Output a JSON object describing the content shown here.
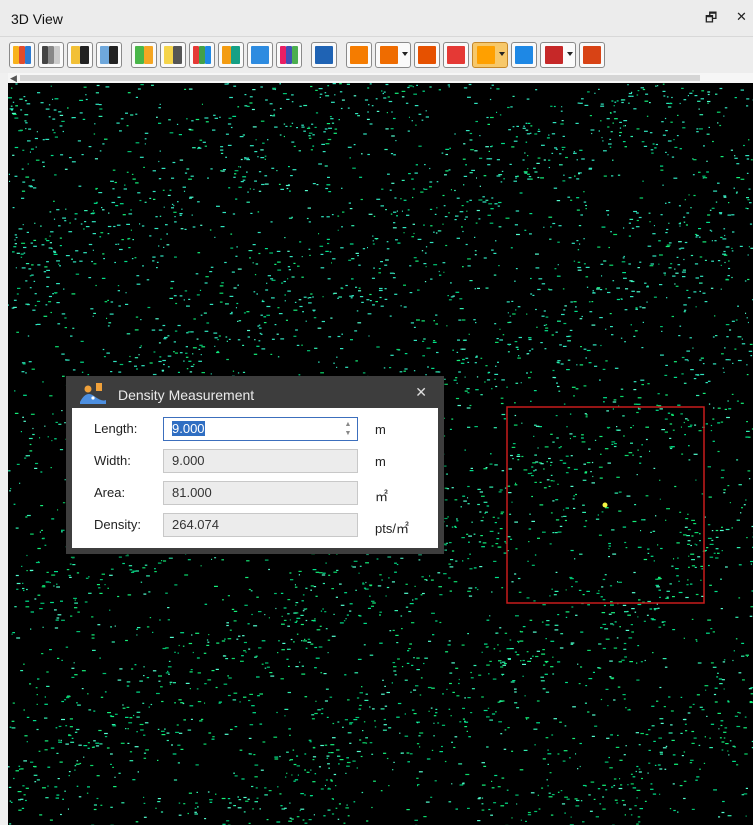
{
  "window": {
    "title": "3D View",
    "float_glyph": "🗗",
    "close_glyph": "✕"
  },
  "toolbar": {
    "buttons": [
      {
        "name": "color-by-elevation",
        "icon": "elevation-icon",
        "colors": [
          "#f8b21b",
          "#e04b2b",
          "#2b7ad1"
        ]
      },
      {
        "name": "color-by-intensity",
        "icon": "intensity-icon",
        "colors": [
          "#444",
          "#888",
          "#ccc"
        ]
      },
      {
        "name": "color-by-classification-en",
        "icon": "en-icon",
        "colors": [
          "#f2c036",
          "#222"
        ]
      },
      {
        "name": "color-by-return",
        "icon": "er-icon",
        "colors": [
          "#6fa8dc",
          "#222"
        ]
      },
      {
        "name": "color-by-point-source",
        "icon": "fp-icon",
        "colors": [
          "#49b649",
          "#f5a623"
        ]
      },
      {
        "name": "color-by-gps-time",
        "icon": "gps-time-icon",
        "colors": [
          "#f5d44a",
          "#555"
        ]
      },
      {
        "name": "color-by-rgb",
        "icon": "rgb-icon",
        "colors": [
          "#e53935",
          "#43a047",
          "#1e88e5"
        ]
      },
      {
        "name": "color-blend",
        "icon": "blend-icon",
        "colors": [
          "#f39c12",
          "#16a085"
        ]
      },
      {
        "name": "display-settings",
        "icon": "sliders-icon",
        "colors": [
          "#2d8be0"
        ]
      },
      {
        "name": "color-bar",
        "icon": "colorbar-icon",
        "colors": [
          "#e91e63",
          "#3f51b5",
          "#4caf50"
        ]
      },
      {
        "name": "measure-distance",
        "icon": "measure-arrows-icon",
        "colors": [
          "#1f63b4"
        ]
      },
      {
        "name": "view-3d",
        "icon": "view-3d-icon",
        "colors": [
          "#f57c00"
        ]
      },
      {
        "name": "view-cube",
        "icon": "cube-icon",
        "colors": [
          "#ef6c00"
        ],
        "dropdown": true
      },
      {
        "name": "center-view",
        "icon": "crosshair-icon",
        "colors": [
          "#e65100"
        ]
      },
      {
        "name": "clip-box",
        "icon": "clip-box-icon",
        "colors": [
          "#e53935"
        ]
      },
      {
        "name": "selection-box",
        "icon": "select-box-icon",
        "colors": [
          "#ffa000"
        ],
        "dropdown": true,
        "active": true
      },
      {
        "name": "draw-polyline",
        "icon": "polyline-icon",
        "colors": [
          "#1e88e5"
        ]
      },
      {
        "name": "visibility",
        "icon": "eye-icon",
        "colors": [
          "#c62828"
        ],
        "dropdown": true
      },
      {
        "name": "cut-tool",
        "icon": "scissors-icon",
        "colors": [
          "#d84315"
        ]
      }
    ]
  },
  "density_dialog": {
    "title": "Density Measurement",
    "close_glyph": "✕",
    "fields": {
      "length": {
        "label": "Length:",
        "value": "9.000",
        "unit": "m"
      },
      "width": {
        "label": "Width:",
        "value": "9.000",
        "unit": "m"
      },
      "area": {
        "label": "Area:",
        "value": "81.000",
        "unit": "㎡"
      },
      "density": {
        "label": "Density:",
        "value": "264.074",
        "unit": "pts/㎡"
      }
    }
  },
  "viewport": {
    "background": "#000000",
    "point_colors": [
      "#00e08a",
      "#14f07a",
      "#2ef0b0",
      "#00c070",
      "#52ffd0",
      "#0bd96a"
    ],
    "selection_color": "#c81c1c",
    "highlight_point_color": "#f5f542"
  }
}
